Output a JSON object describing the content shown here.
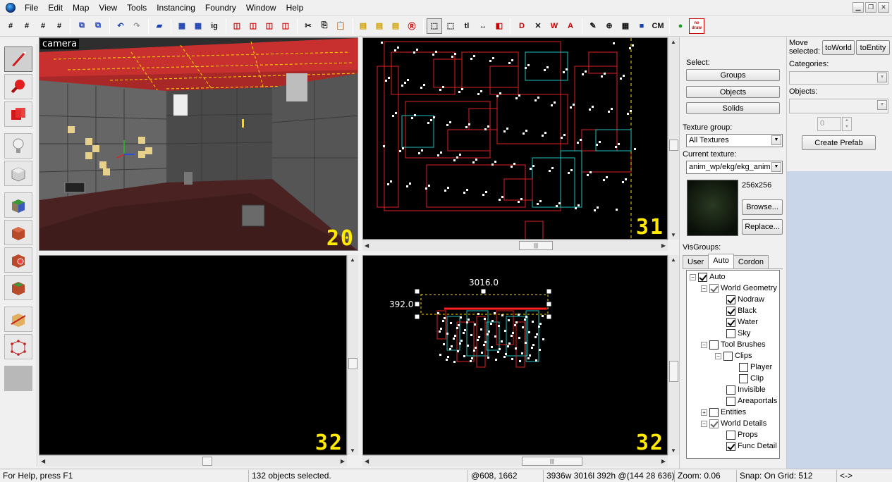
{
  "menu": [
    "File",
    "Edit",
    "Map",
    "View",
    "Tools",
    "Instancing",
    "Foundry",
    "Window",
    "Help"
  ],
  "toolbar": {
    "ig_label": "ig",
    "tl_label": "tl",
    "cm_label": "CM",
    "nodraw_top": "no",
    "nodraw_bottom": "draw"
  },
  "viewports": {
    "camera": {
      "label": "camera",
      "zoom": "20"
    },
    "top_right": {
      "zoom": "31"
    },
    "bottom_left": {
      "zoom": "32"
    },
    "bottom_right": {
      "zoom": "32",
      "width_dim": "3016.0",
      "height_dim": "392.0"
    }
  },
  "select_panel": {
    "select_label": "Select:",
    "groups": "Groups",
    "objects": "Objects",
    "solids": "Solids",
    "texture_group_label": "Texture group:",
    "texture_group_value": "All Textures",
    "current_texture_label": "Current texture:",
    "current_texture_value": "anim_wp/ekg/ekg_anim",
    "texture_size": "256x256",
    "browse": "Browse...",
    "replace": "Replace...",
    "visgroups_label": "VisGroups:"
  },
  "visgroup_tabs": [
    "User",
    "Auto",
    "Cordon"
  ],
  "visgroups": {
    "auto": "Auto",
    "world_geometry": "World Geometry",
    "nodraw": "Nodraw",
    "black": "Black",
    "water": "Water",
    "sky": "Sky",
    "tool_brushes": "Tool Brushes",
    "clips": "Clips",
    "player": "Player",
    "clip": "Clip",
    "invisible": "Invisible",
    "areaportals": "Areaportals",
    "entities": "Entities",
    "world_details": "World Details",
    "props": "Props",
    "func_detail": "Func Detail"
  },
  "move_panel": {
    "move_label_1": "Move",
    "move_label_2": "selected:",
    "to_world": "toWorld",
    "to_entity": "toEntity",
    "categories_label": "Categories:",
    "objects_label": "Objects:",
    "count_value": "0",
    "create_prefab": "Create Prefab"
  },
  "status": {
    "help": "For Help, press F1",
    "selection": "132 objects selected.",
    "coords": "@608, 1662",
    "size": "3936w 3016l 392h @(144 28 636)",
    "zoom": "Zoom: 0.06",
    "snap": "Snap: On Grid: 512",
    "arrows": "<->"
  },
  "colors": {
    "viewport_bg": "#000000",
    "zoom_digits": "#ffea00",
    "brush_red": "#e02020",
    "brush_cyan": "#20c0c0",
    "selection_red": "#ff2020"
  }
}
